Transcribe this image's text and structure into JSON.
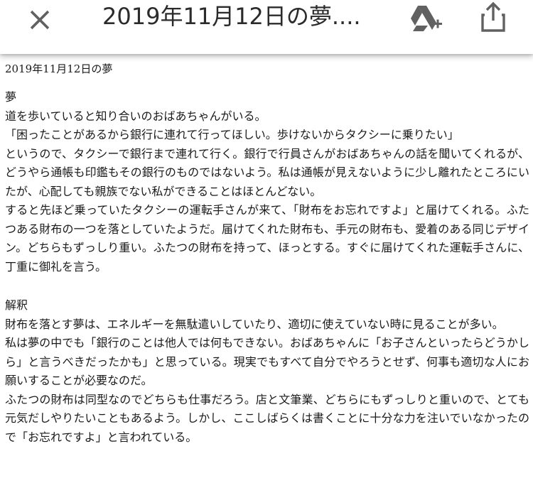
{
  "header": {
    "title": "2019年11月12日の夢....",
    "close_icon": "close-icon",
    "drive_icon": "google-drive-add-icon",
    "share_icon": "share-icon"
  },
  "document": {
    "date_heading": "2019年11月12日の夢",
    "dream_heading": "夢",
    "dream_paragraphs": [
      "道を歩いていると知り合いのおばあちゃんがいる。",
      "「困ったことがあるから銀行に連れて行ってほしい。歩けないからタクシーに乗りたい」",
      "というので、タクシーで銀行まで連れて行く。銀行で行員さんがおばあちゃんの話を聞いてくれるが、どうやら通帳も印鑑もその銀行のものではないよう。私は通帳が見えないように少し離れたところにいたが、心配しても親族でない私ができることはほとんどない。",
      "すると先ほど乗っていたタクシーの運転手さんが来て、「財布をお忘れですよ」と届けてくれる。ふたつある財布の一つを落としていたようだ。届けてくれた財布も、手元の財布も、愛着のある同じデザイン。どちらもずっしり重い。ふたつの財布を持って、ほっとする。すぐに届けてくれた運転手さんに、丁重に御礼を言う。"
    ],
    "interpretation_heading": "解釈",
    "interpretation_paragraphs": [
      "財布を落とす夢は、エネルギーを無駄遣いしていたり、適切に使えていない時に見ることが多い。",
      "私は夢の中でも「銀行のことは他人では何もできない。おばあちゃんに「お子さんといったらどうかしら」と言うべきだったかも」と思っている。現実でもすべて自分でやろうとせず、何事も適切な人にお願いすることが必要なのだ。",
      "ふたつの財布は同型なのでどちらも仕事だろう。店と文筆業、どちらにもずっしりと重いので、とても元気だしやりたいこともあるよう。しかし、ここしばらくは書くことに十分な力を注いでいなかったので「お忘れですよ」と言われている。"
    ]
  },
  "colors": {
    "icon": "#616161",
    "text": "#1a1a1a",
    "background": "#ffffff"
  }
}
